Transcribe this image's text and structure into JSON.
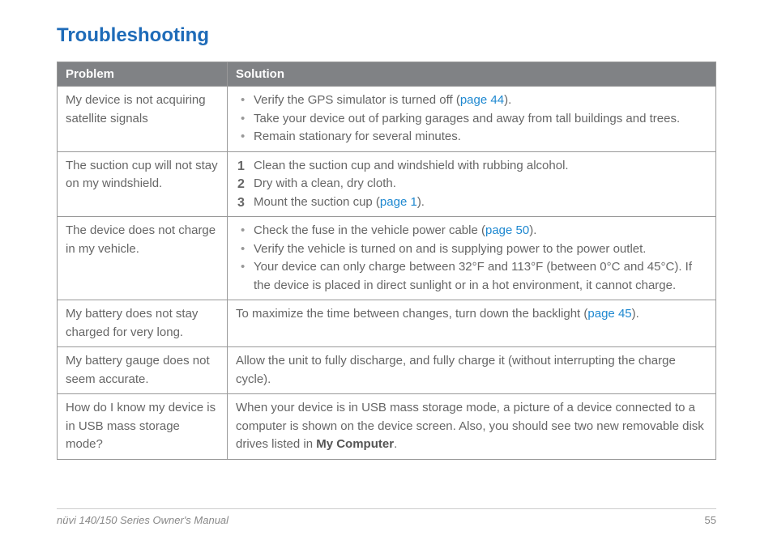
{
  "title": "Troubleshooting",
  "headers": {
    "problem": "Problem",
    "solution": "Solution"
  },
  "rows": {
    "r1": {
      "problem": "My device is not acquiring satellite signals",
      "b1a": "Verify the GPS simulator is turned off (",
      "b1link": "page 44",
      "b1b": ").",
      "b2": "Take your device out of parking garages and away from tall buildings and trees.",
      "b3": "Remain stationary for several minutes."
    },
    "r2": {
      "problem": "The suction cup will not stay on my windshield.",
      "s1": "Clean the suction cup and windshield with rubbing alcohol.",
      "s2": "Dry with a clean, dry cloth.",
      "s3a": "Mount the suction cup (",
      "s3link": "page 1",
      "s3b": ")."
    },
    "r3": {
      "problem": "The device does not charge in my vehicle.",
      "b1a": "Check the fuse in the vehicle power cable (",
      "b1link": "page 50",
      "b1b": ").",
      "b2": "Verify the vehicle is turned on and is supplying power to the power outlet.",
      "b3": "Your device can only charge between 32°F and 113°F (between 0°C and 45°C). If the device is placed in direct sunlight or in a hot environment, it cannot charge."
    },
    "r4": {
      "problem": "My battery does not stay charged for very long.",
      "sa": "To maximize the time between changes, turn down the backlight (",
      "slink": "page 45",
      "sb": ")."
    },
    "r5": {
      "problem": "My battery gauge does not seem accurate.",
      "s": "Allow the unit to fully discharge, and fully charge it (without interrupting the charge cycle)."
    },
    "r6": {
      "problem": "How do I know my device is in USB mass storage mode?",
      "sa": "When your device is in USB mass storage mode, a picture of a device connected to a computer is shown on the device screen. Also, you should see two new removable disk drives listed in ",
      "sbold": "My Computer",
      "sb": "."
    }
  },
  "footer": {
    "manual": "nüvi 140/150 Series Owner's Manual",
    "page": "55"
  }
}
